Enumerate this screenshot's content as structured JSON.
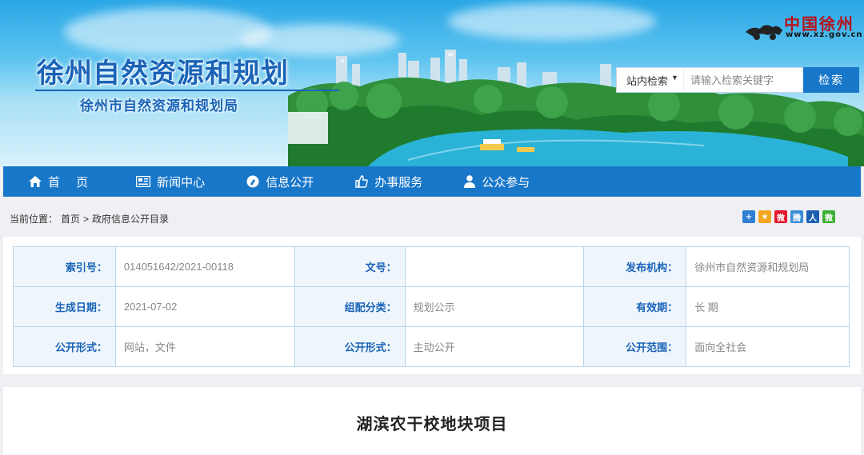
{
  "header": {
    "site_title": "徐州自然资源和规划",
    "site_subtitle": "徐州市自然资源和规划局",
    "logo_text": "中国徐州",
    "logo_url": "www.xz.gov.cn"
  },
  "search": {
    "scope": "站内检索",
    "placeholder": "请输入检索关键字",
    "button": "检索"
  },
  "nav": {
    "items": [
      {
        "label": "首 页",
        "icon": "home-icon"
      },
      {
        "label": "新闻中心",
        "icon": "news-icon"
      },
      {
        "label": "信息公开",
        "icon": "info-icon"
      },
      {
        "label": "办事服务",
        "icon": "thumbs-up-icon"
      },
      {
        "label": "公众参与",
        "icon": "person-icon"
      }
    ]
  },
  "breadcrumb": {
    "prefix": "当前位置：",
    "home": "首页",
    "separator": ">",
    "current": "政府信息公开目录"
  },
  "share": {
    "icons": [
      {
        "name": "add-share-icon",
        "glyph": "+",
        "color": "#2f7fd1"
      },
      {
        "name": "qzone-icon",
        "glyph": "★",
        "color": "#f5a623"
      },
      {
        "name": "weibo-icon",
        "glyph": "微",
        "color": "#e6162d"
      },
      {
        "name": "tencent-weibo-icon",
        "glyph": "腾",
        "color": "#3c8fd6"
      },
      {
        "name": "renren-icon",
        "glyph": "人",
        "color": "#1c5fb4"
      },
      {
        "name": "wechat-icon",
        "glyph": "微",
        "color": "#3cb034"
      }
    ]
  },
  "meta": {
    "rows": [
      [
        {
          "key": "索引号：",
          "value": "014051642/2021-00118"
        },
        {
          "key": "文号：",
          "value": ""
        },
        {
          "key": "发布机构：",
          "value": "徐州市自然资源和规划局"
        }
      ],
      [
        {
          "key": "生成日期：",
          "value": "2021-07-02"
        },
        {
          "key": "组配分类：",
          "value": "规划公示"
        },
        {
          "key": "有效期：",
          "value": "长 期"
        }
      ],
      [
        {
          "key": "公开形式：",
          "value": "网站，文件"
        },
        {
          "key": "公开形式：",
          "value": "主动公开"
        },
        {
          "key": "公开范围：",
          "value": "面向全社会"
        }
      ]
    ]
  },
  "document": {
    "title": "湖滨农干校地块项目"
  },
  "colors": {
    "brand_blue": "#1877c9",
    "title_blue": "#1a63b7",
    "logo_red": "#b5121b"
  }
}
